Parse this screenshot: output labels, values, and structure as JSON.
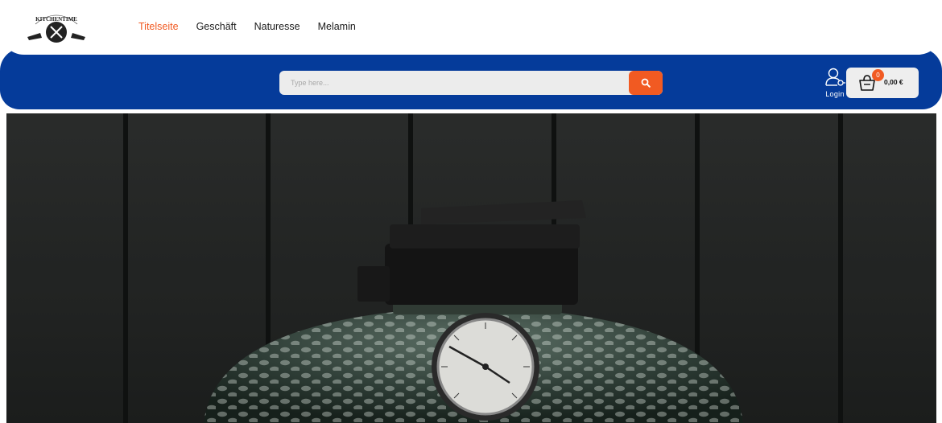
{
  "brand": {
    "logo_text": "KITCHENTIME",
    "logo_icon": "crossed-utensils-badge"
  },
  "nav": {
    "items": [
      {
        "label": "Titelseite",
        "active": true
      },
      {
        "label": "Geschäft",
        "active": false
      },
      {
        "label": "Naturesse",
        "active": false
      },
      {
        "label": "Melamin",
        "active": false
      }
    ]
  },
  "search": {
    "placeholder": "Type here...",
    "icon": "search-icon"
  },
  "account": {
    "login_label": "Login",
    "icon": "user-icon"
  },
  "cart": {
    "count": "0",
    "total": "0,00 €",
    "icon": "shopping-bag-icon"
  },
  "hero": {
    "image_description_icon": "kamado-grill-photo"
  },
  "colors": {
    "accent": "#f15a22",
    "brand_blue": "#053b9a",
    "background": "#ffffff"
  }
}
